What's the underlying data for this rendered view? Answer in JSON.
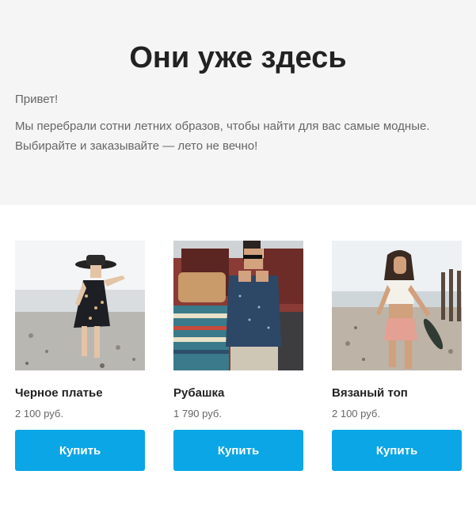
{
  "hero": {
    "title": "Они уже здесь",
    "greeting": "Привет!",
    "intro": "Мы перебрали сотни летних образов, чтобы найти для вас самые модные. Выбирайте и заказывайте — лето не вечно!"
  },
  "products": [
    {
      "name": "Черное платье",
      "price": "2 100 руб.",
      "button": "Купить"
    },
    {
      "name": "Рубашка",
      "price": "1 790 руб.",
      "button": "Купить"
    },
    {
      "name": "Вязаный топ",
      "price": "2 100 руб.",
      "button": "Купить"
    }
  ],
  "colors": {
    "hero_bg": "#f5f5f5",
    "button": "#0aa6e6",
    "text": "#222222",
    "muted": "#666666"
  }
}
